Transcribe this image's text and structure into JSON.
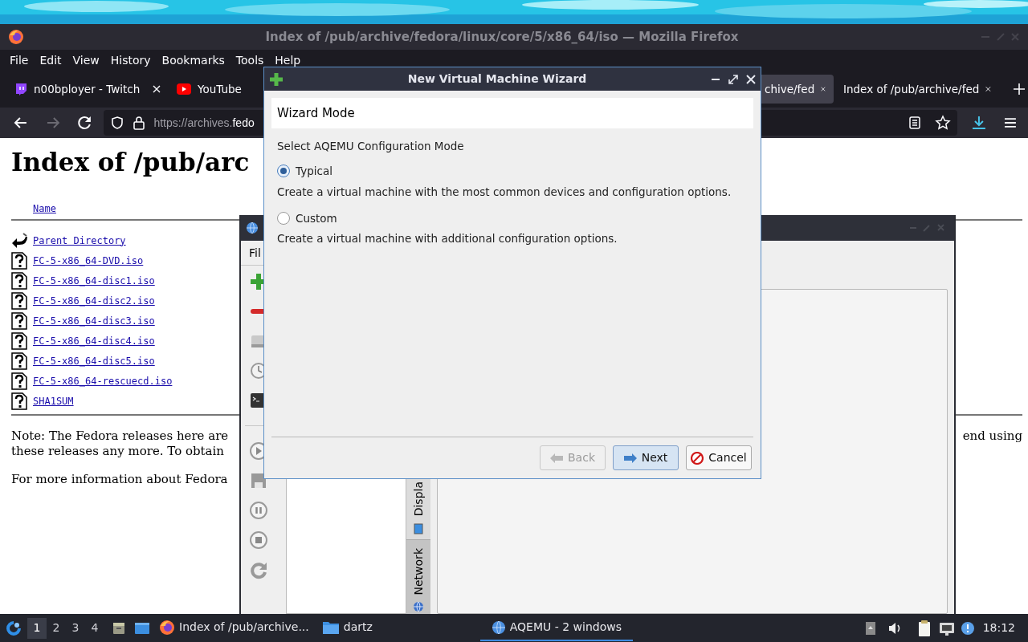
{
  "firefox": {
    "title": "Index of /pub/archive/fedora/linux/core/5/x86_64/iso — Mozilla Firefox",
    "menu": [
      "File",
      "Edit",
      "View",
      "History",
      "Bookmarks",
      "Tools",
      "Help"
    ],
    "tabs": [
      {
        "label": "n00bployer - Twitch",
        "selected": false
      },
      {
        "label": "YouTube",
        "selected": false
      },
      {
        "label": "chive/fed",
        "selected": true
      },
      {
        "label": "Index of /pub/archive/fed",
        "selected": false
      }
    ],
    "url": {
      "scheme": "https://archives.",
      "host": "fedo"
    },
    "page": {
      "heading": "Index of /pub/arc",
      "column_header": "Name",
      "files": [
        {
          "name": "Parent Directory",
          "kind": "parent"
        },
        {
          "name": "FC-5-x86_64-DVD.iso",
          "kind": "file"
        },
        {
          "name": "FC-5-x86_64-disc1.iso",
          "kind": "file"
        },
        {
          "name": "FC-5-x86_64-disc2.iso",
          "kind": "file"
        },
        {
          "name": "FC-5-x86_64-disc3.iso",
          "kind": "file"
        },
        {
          "name": "FC-5-x86_64-disc4.iso",
          "kind": "file"
        },
        {
          "name": "FC-5-x86_64-disc5.iso",
          "kind": "file"
        },
        {
          "name": "FC-5-x86_64-rescuecd.iso",
          "kind": "file"
        },
        {
          "name": "SHA1SUM",
          "kind": "file"
        }
      ],
      "note_lines": [
        "Note: The Fedora releases here are",
        "these releases any more. To obtain"
      ],
      "note_right": "end using",
      "info": "For more information about Fedora"
    }
  },
  "aqemu": {
    "menu": "Fil",
    "vertical_tabs": [
      "Displa",
      "Network"
    ]
  },
  "wizard": {
    "title": "New Virtual Machine Wizard",
    "header": "Wizard Mode",
    "prompt": "Select AQEMU Configuration Mode",
    "options": [
      {
        "label": "Typical",
        "description": "Create a virtual machine with the most common devices and configuration options.",
        "selected": true
      },
      {
        "label": "Custom",
        "description": "Create a virtual machine with additional configuration options.",
        "selected": false
      }
    ],
    "buttons": [
      {
        "label": "Back",
        "kind": "back",
        "disabled": true,
        "focused": false
      },
      {
        "label": "Next",
        "kind": "next",
        "disabled": false,
        "focused": true
      },
      {
        "label": "Cancel",
        "kind": "cancel",
        "disabled": false,
        "focused": false
      }
    ]
  },
  "taskbar": {
    "workspaces": [
      {
        "label": "1",
        "selected": true
      },
      {
        "label": "2",
        "selected": false
      },
      {
        "label": "3",
        "selected": false
      },
      {
        "label": "4",
        "selected": false
      }
    ],
    "windows": [
      {
        "label": "Index of /pub/archive...",
        "active": false
      },
      {
        "label": "dartz",
        "active": false
      },
      {
        "label": "AQEMU - 2 windows",
        "active": true
      }
    ],
    "clock": "18:12"
  }
}
